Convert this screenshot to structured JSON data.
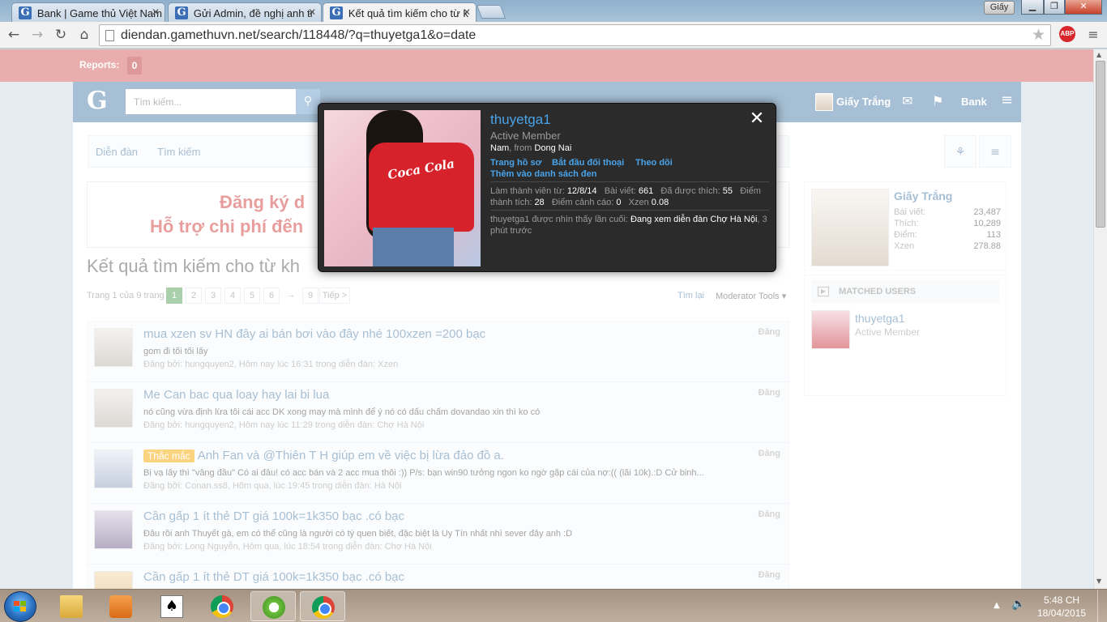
{
  "browser": {
    "tabs": [
      {
        "label": "Bank | Game thủ Việt Nam",
        "active": false
      },
      {
        "label": "Gửi Admin, đề nghị anh tr",
        "active": false
      },
      {
        "label": "Kết quả tìm kiếm cho từ k",
        "active": true
      }
    ],
    "user_badge": "Giấy",
    "url": "diendan.gamethuvn.net/search/118448/?q=thuyetga1&o=date",
    "extension_label": "ABP"
  },
  "reports": {
    "label": "Reports:",
    "count": "0"
  },
  "header": {
    "logo": "G",
    "search_placeholder": "Tìm kiếm...",
    "username": "Giấy Trắng",
    "bank_label": "Bank"
  },
  "breadcrumb": [
    "Diễn đàn",
    "Tìm kiếm"
  ],
  "banner": {
    "line1": "Đăng ký d",
    "line2": "Hỗ trợ chi phí đến"
  },
  "results_title": "Kết quả tìm kiếm cho từ kh",
  "pagination": {
    "info": "Trang 1 của 9 trang",
    "pages": [
      "1",
      "2",
      "3",
      "4",
      "5",
      "6",
      "→",
      "9"
    ],
    "current": "1",
    "next_label": "Tiếp >",
    "search_again": "Tìm lại",
    "mod_tools": "Moderator Tools ▾"
  },
  "results": [
    {
      "prefix": "",
      "title": "mua xzen sv HN đây ai bán bơi vào đây nhé 100xzen =200 bạc",
      "snippet": "gom đi tối tối lấy",
      "meta": "Đăng bởi: hungquyen2, Hôm nay lúc 16:31 trong diễn đàn: Xzen",
      "type": "Đăng"
    },
    {
      "prefix": "",
      "title": "Me Can bac qua loay hay lai bi lua",
      "snippet": "nó cũng vừa định lừa tôi cái acc DK xong may mà mình để ý nó có dấu chấm dovandao xin thì ko có",
      "meta": "Đăng bởi: hungquyen2, Hôm nay lúc 11:29 trong diễn đàn: Chợ Hà Nội",
      "type": "Đăng"
    },
    {
      "prefix": "Thắc mắc",
      "title": "Anh Fan và @Thiên T H giúp em về việc bị lừa đảo đồ a.",
      "snippet": "Bị vạ lấy thì \"vâng đầu\" Có ai đâu! có acc bán và 2 acc mua thôi :)) P/s: bạn win90 tưởng ngon ko ngờ gặp cái của nợ:(( (lãi 10k).:D Cử binh...",
      "meta": "Đăng bởi: Conan.ss8, Hôm qua, lúc 19:45 trong diễn đàn: Hà Nội",
      "type": "Đăng"
    },
    {
      "prefix": "",
      "title": "Cần gấp 1 ít thẻ DT giá 100k=1k350 bạc .có bạc",
      "snippet": "Đâu rồi anh Thuyết gà, em có thể cũng là người có tý quen biết, đặc biệt là Uy Tín nhất nhì sever đây anh :D",
      "meta": "Đăng bởi: Long Nguyễn, Hôm qua, lúc 18:54 trong diễn đàn: Chợ Hà Nội",
      "type": "Đăng"
    },
    {
      "prefix": "",
      "title": "Cần gấp 1 ít thẻ DT giá 100k=1k350 bạc .có bạc",
      "snippet": "",
      "meta": "",
      "type": "Đăng"
    }
  ],
  "sidebar": {
    "name": "Giấy Trắng",
    "stats": [
      {
        "label": "Bài viết:",
        "value": "23,487"
      },
      {
        "label": "Thích:",
        "value": "10,289"
      },
      {
        "label": "Điểm:",
        "value": "113"
      },
      {
        "label": "Xzen",
        "value": "278.88"
      }
    ],
    "matched_heading": "MATCHED USERS",
    "matched_user": {
      "name": "thuyetga1",
      "title": "Active Member"
    }
  },
  "member_card": {
    "name": "thuyetga1",
    "title": "Active Member",
    "gender": "Nam",
    "from_label": ", from ",
    "location": "Dong Nai",
    "links": {
      "profile": "Trang hồ sơ",
      "conversation": "Bắt đầu đối thoại",
      "follow": "Theo dõi",
      "ignore": "Thêm vào danh sách đen"
    },
    "stats": {
      "joined_label": "Làm thành viên từ:",
      "joined": "12/8/14",
      "posts_label": "Bài viết:",
      "posts": "661",
      "likes_label": "Đã được thích:",
      "likes": "55",
      "trophy_label": "Điểm thành tích:",
      "trophy": "28",
      "warning_label": "Điểm cảnh cáo:",
      "warning": "0",
      "xzen_label": "Xzen",
      "xzen": "0.08"
    },
    "last_seen_prefix": "thuyetga1 được nhìn thấy lần cuối:",
    "last_seen_activity": "Đang xem diễn đàn Chợ Hà Nội",
    "last_seen_time": ", 3 phút trước",
    "photo_text": "Coca Cola"
  },
  "taskbar": {
    "time": "5:48 CH",
    "date": "18/04/2015"
  },
  "colors": {
    "brand": "#4d7ea8",
    "reports_bar": "#d25a5a",
    "link": "#4aa3e8",
    "popup_bg": "#2b2b2b"
  }
}
